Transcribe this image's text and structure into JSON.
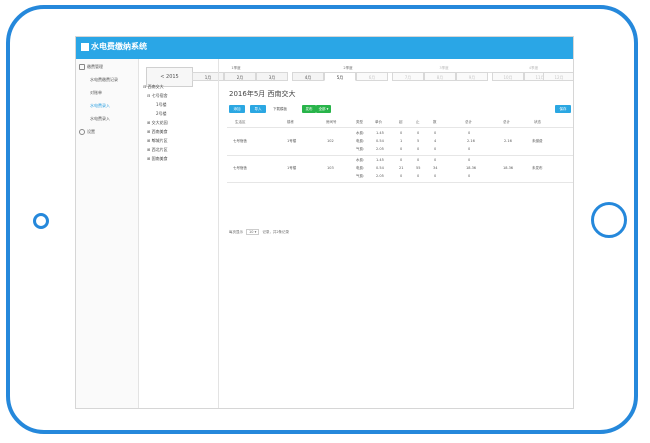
{
  "app": {
    "title": "水电费缴纳系统"
  },
  "sidebar": {
    "items": [
      {
        "label": "缴费管理",
        "type": "group"
      },
      {
        "label": "水电费缴费记录",
        "type": "sub"
      },
      {
        "label": "对账单",
        "type": "sub"
      },
      {
        "label": "水电费录入",
        "type": "sub",
        "active": true
      },
      {
        "label": "水电费录入",
        "type": "sub"
      },
      {
        "label": "设置",
        "type": "group"
      }
    ]
  },
  "year_nav": {
    "prev_label": "< 2015"
  },
  "quarters": [
    {
      "label": "1季度",
      "dim": false
    },
    {
      "label": "2季度",
      "dim": false
    },
    {
      "label": "3季度",
      "dim": true
    },
    {
      "label": "4季度",
      "dim": true
    }
  ],
  "months": [
    {
      "label": "1月",
      "state": "normal"
    },
    {
      "label": "2月",
      "state": "normal"
    },
    {
      "label": "3月",
      "state": "normal"
    },
    {
      "label": "4月",
      "state": "normal"
    },
    {
      "label": "5月",
      "state": "active"
    },
    {
      "label": "6月",
      "state": "dim"
    },
    {
      "label": "7月",
      "state": "dim"
    },
    {
      "label": "8月",
      "state": "dim"
    },
    {
      "label": "9月",
      "state": "dim"
    },
    {
      "label": "10月",
      "state": "dim"
    },
    {
      "label": "11月",
      "state": "dim"
    },
    {
      "label": "12月",
      "state": "dim"
    }
  ],
  "tree": {
    "root": "西南交大",
    "items": [
      {
        "label": "七号宿舍",
        "level": 1
      },
      {
        "label": "1号楼",
        "level": 2
      },
      {
        "label": "2号楼",
        "level": 2
      },
      {
        "label": "交大花园",
        "level": 1
      },
      {
        "label": "西南美食",
        "level": 1
      },
      {
        "label": "郫城片区",
        "level": 1
      },
      {
        "label": "西北片区",
        "level": 1
      },
      {
        "label": "国南美食",
        "level": 1
      }
    ]
  },
  "content": {
    "title": "2016年5月 西南交大",
    "buttons": {
      "add": "添加",
      "import": "导入",
      "download": "下载模板",
      "publish": "发布",
      "more": "全部 ▾",
      "right": "保存"
    },
    "headers": [
      "生活区",
      "楼栋",
      "房间号",
      "类型",
      "单价",
      "起",
      "止",
      "数",
      "总计",
      "总计",
      "状态"
    ],
    "rows": [
      {
        "area": "七号宿舍",
        "building": "1号楼",
        "room": "102",
        "lines": [
          {
            "type": "水费:",
            "price": "1.45",
            "start": "0",
            "end": "0",
            "qty": "0",
            "sub": "0"
          },
          {
            "type": "电费:",
            "price": "0.54",
            "start": "1",
            "end": "5",
            "qty": "4",
            "sub": "2.16"
          },
          {
            "type": "气费:",
            "price": "2.05",
            "start": "0",
            "end": "0",
            "qty": "0",
            "sub": "0"
          }
        ],
        "total": "2.16",
        "status": "未缴费"
      },
      {
        "area": "七号宿舍",
        "building": "1号楼",
        "room": "103",
        "lines": [
          {
            "type": "水费:",
            "price": "1.45",
            "start": "0",
            "end": "0",
            "qty": "0",
            "sub": "0"
          },
          {
            "type": "电费:",
            "price": "0.54",
            "start": "21",
            "end": "55",
            "qty": "34",
            "sub": "18.36"
          },
          {
            "type": "气费:",
            "price": "2.05",
            "start": "0",
            "end": "0",
            "qty": "0",
            "sub": "0"
          }
        ],
        "total": "18.36",
        "status": "未发布"
      }
    ],
    "footer": {
      "prefix": "每页显示",
      "page_size": "10 ▾",
      "suffix": "记录，共2条记录"
    }
  }
}
